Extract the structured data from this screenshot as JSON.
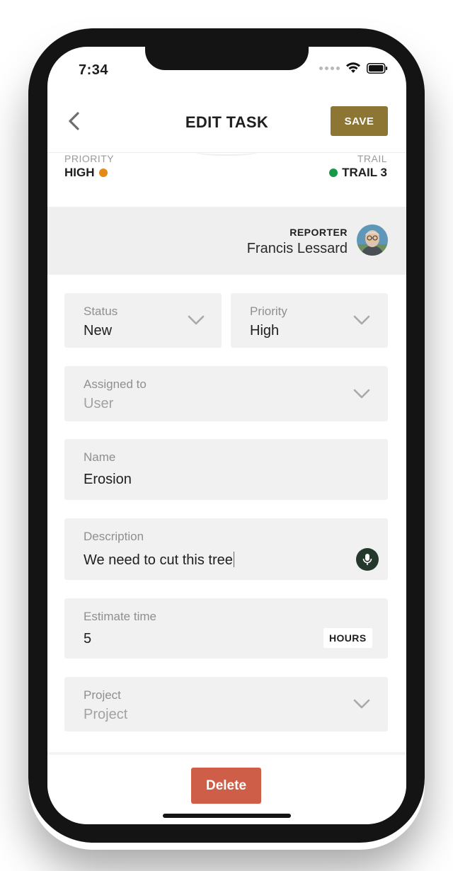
{
  "status_bar": {
    "time": "7:34"
  },
  "nav": {
    "title": "EDIT TASK",
    "save_label": "SAVE"
  },
  "summary": {
    "priority_label": "PRIORITY",
    "priority_value": "HIGH",
    "priority_color": "#e58a14",
    "trail_label": "TRAIL",
    "trail_value": "TRAIL 3",
    "trail_color": "#169a4a"
  },
  "reporter": {
    "label": "REPORTER",
    "name": "Francis Lessard"
  },
  "form": {
    "status": {
      "label": "Status",
      "value": "New"
    },
    "priority": {
      "label": "Priority",
      "value": "High"
    },
    "assigned_to": {
      "label": "Assigned to",
      "placeholder": "User"
    },
    "name": {
      "label": "Name",
      "value": "Erosion"
    },
    "description": {
      "label": "Description",
      "value": "We need to cut this tree"
    },
    "estimate_time": {
      "label": "Estimate time",
      "value": "5",
      "unit": "HOURS"
    },
    "project": {
      "label": "Project",
      "placeholder": "Project"
    }
  },
  "actions": {
    "delete_label": "Delete"
  },
  "colors": {
    "save_button": "#8d7634",
    "delete_button": "#cf5e48",
    "mic_button": "#24392c"
  }
}
